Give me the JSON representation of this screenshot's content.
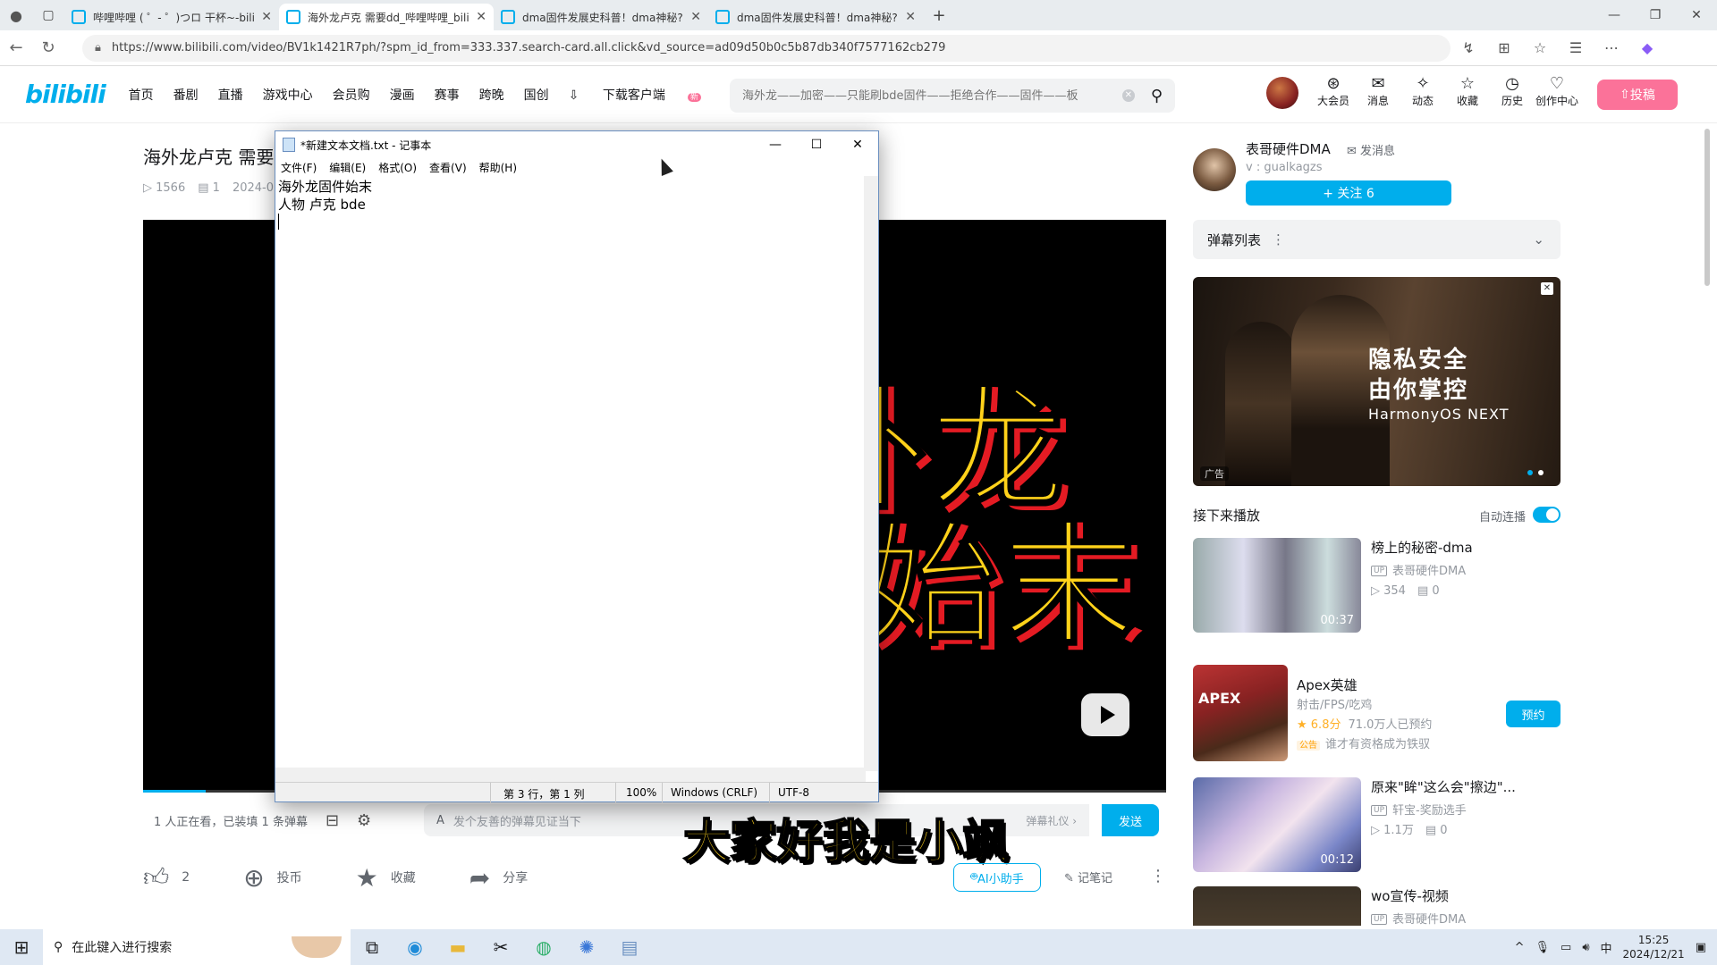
{
  "browser": {
    "tabs": [
      {
        "title": "哔哩哔哩 ( ゜- ゜)つロ 干杯~-bilib",
        "active": false
      },
      {
        "title": "海外龙卢克 需要dd_哔哩哔哩_bili",
        "active": true
      },
      {
        "title": "dma固件发展史科普！dma神秘?",
        "active": false
      },
      {
        "title": "dma固件发展史科普！dma神秘?",
        "active": false
      }
    ],
    "url": "https://www.bilibili.com/video/BV1k1421R7ph/?spm_id_from=333.337.search-card.all.click&vd_source=ad09d50b0c5b87db340f7577162cb279"
  },
  "header": {
    "logo": "bilibili",
    "nav": [
      "首页",
      "番剧",
      "直播",
      "游戏中心",
      "会员购",
      "漫画",
      "赛事",
      "跨晚",
      "国创",
      "下载客户端"
    ],
    "nav_badge": "新",
    "search_placeholder": "海外龙——加密——只能刷bde固件——拒绝合作——固件——板",
    "icons": [
      {
        "label": "大会员",
        "icon": "vip-icon"
      },
      {
        "label": "消息",
        "icon": "message-icon"
      },
      {
        "label": "动态",
        "icon": "dynamic-icon"
      },
      {
        "label": "收藏",
        "icon": "favorite-icon"
      },
      {
        "label": "历史",
        "icon": "history-icon"
      },
      {
        "label": "创作中心",
        "icon": "creator-icon"
      }
    ],
    "upload_label": "投稿"
  },
  "video": {
    "title": "海外龙卢克 需要dd",
    "views": "1566",
    "danmaku_count": "1",
    "date": "2024-0",
    "overlay_line1": "海外龙",
    "overlay_line2": "板子始末",
    "subtitle": "大家好我是小飒",
    "watching": "1 人正在看，已装填 1 条弹幕",
    "danmaku_placeholder": "发个友善的弹幕见证当下",
    "danmaku_etiquette": "弹幕礼仪 ›",
    "send_label": "发送",
    "likes": "2",
    "coin_label": "投币",
    "fav_label": "收藏",
    "share_label": "分享",
    "ai_label": "AI小助手",
    "notes_label": "记笔记"
  },
  "uploader": {
    "name": "表哥硬件DMA",
    "message_label": "发消息",
    "sign": "v : gualkagzs",
    "follow_label": "+ 关注 6"
  },
  "sidebar": {
    "danmaku_list_label": "弹幕列表",
    "ad": {
      "line1": "隐私安全",
      "line2": "由你掌控",
      "line3": "HarmonyOS NEXT",
      "tag": "广告"
    },
    "next_label": "接下来播放",
    "autoplay_label": "自动连播",
    "recommendations": [
      {
        "title": "榜上的秘密-dma",
        "up": "表哥硬件DMA",
        "views": "354",
        "danmaku": "0",
        "duration": "00:37"
      },
      {
        "title": "原来\"眸\"这么会\"擦边\"...",
        "up": "轩宝-奖励选手",
        "views": "1.1万",
        "danmaku": "0",
        "duration": "00:12"
      },
      {
        "title": "wo宣传-视频",
        "up": "表哥硬件DMA",
        "views": "",
        "danmaku": "",
        "duration": ""
      }
    ],
    "game": {
      "name": "Apex英雄",
      "thumb_text": "APEX",
      "genre": "射击/FPS/吃鸡",
      "rating": "★ 6.8分",
      "reserved": "71.0万人已预约",
      "notice_tag": "公告",
      "notice": "谁才有资格成为铁驭",
      "reserve_label": "预约"
    }
  },
  "notepad": {
    "title": "*新建文本文档.txt - 记事本",
    "menu": [
      "文件(F)",
      "编辑(E)",
      "格式(O)",
      "查看(V)",
      "帮助(H)"
    ],
    "lines": [
      "海外龙固件始末",
      "人物 卢克 bde"
    ],
    "status_pos": "第 3 行，第 1 列",
    "status_zoom": "100%",
    "status_eol": "Windows (CRLF)",
    "status_enc": "UTF-8"
  },
  "taskbar": {
    "search_placeholder": "在此键入进行搜索",
    "time": "15:25",
    "date": "2024/12/21",
    "ime": "中"
  }
}
